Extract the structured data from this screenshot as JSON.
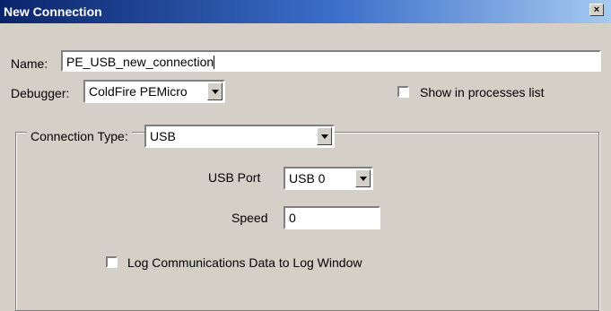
{
  "window": {
    "title": "New Connection",
    "close_glyph": "×"
  },
  "name": {
    "label": "Name:",
    "value": "PE_USB_new_connection"
  },
  "debugger": {
    "label": "Debugger:",
    "selected": "ColdFire PEMicro"
  },
  "show_processes": {
    "label": "Show in processes list",
    "checked": false
  },
  "connection": {
    "type_label": "Connection Type:",
    "type_selected": "USB",
    "usb_port": {
      "label": "USB Port",
      "selected": "USB 0"
    },
    "speed": {
      "label": "Speed",
      "value": "0"
    },
    "log_comms": {
      "label": "Log Communications Data to Log Window",
      "checked": false
    }
  },
  "icons": {
    "close": "close-icon",
    "dropdown": "chevron-down-icon",
    "checkbox": "checkbox-icon"
  }
}
